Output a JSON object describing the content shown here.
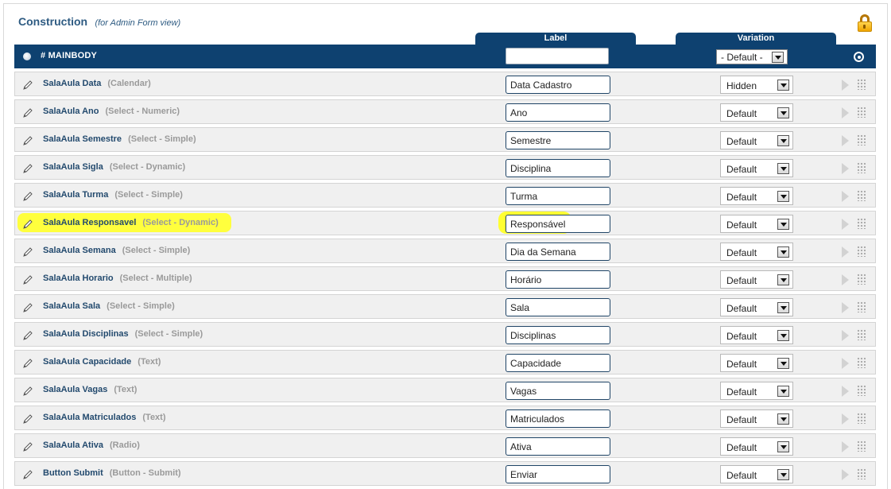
{
  "header": {
    "title": "Construction",
    "subtitle": "(for Admin Form view)"
  },
  "columns": {
    "label": "Label",
    "variation": "Variation"
  },
  "mainbody": {
    "title": "# MAINBODY",
    "label_value": "",
    "variation_value": "- Default -"
  },
  "rows": [
    {
      "name": "SalaAula Data",
      "type": "(Calendar)",
      "label": "Data Cadastro",
      "variation": "Hidden",
      "highlight": false
    },
    {
      "name": "SalaAula Ano",
      "type": "(Select - Numeric)",
      "label": "Ano",
      "variation": "Default",
      "highlight": false
    },
    {
      "name": "SalaAula Semestre",
      "type": "(Select - Simple)",
      "label": "Semestre",
      "variation": "Default",
      "highlight": false
    },
    {
      "name": "SalaAula Sigla",
      "type": "(Select - Dynamic)",
      "label": "Disciplina",
      "variation": "Default",
      "highlight": false
    },
    {
      "name": "SalaAula Turma",
      "type": "(Select - Simple)",
      "label": "Turma",
      "variation": "Default",
      "highlight": false
    },
    {
      "name": "SalaAula Responsavel",
      "type": "(Select - Dynamic)",
      "label": "Responsável",
      "variation": "Default",
      "highlight": true
    },
    {
      "name": "SalaAula Semana",
      "type": "(Select - Simple)",
      "label": "Dia da Semana",
      "variation": "Default",
      "highlight": false
    },
    {
      "name": "SalaAula Horario",
      "type": "(Select - Multiple)",
      "label": "Horário",
      "variation": "Default",
      "highlight": false
    },
    {
      "name": "SalaAula Sala",
      "type": "(Select - Simple)",
      "label": "Sala",
      "variation": "Default",
      "highlight": false
    },
    {
      "name": "SalaAula Disciplinas",
      "type": "(Select - Simple)",
      "label": "Disciplinas",
      "variation": "Default",
      "highlight": false
    },
    {
      "name": "SalaAula Capacidade",
      "type": "(Text)",
      "label": "Capacidade",
      "variation": "Default",
      "highlight": false
    },
    {
      "name": "SalaAula Vagas",
      "type": "(Text)",
      "label": "Vagas",
      "variation": "Default",
      "highlight": false
    },
    {
      "name": "SalaAula Matriculados",
      "type": "(Text)",
      "label": "Matriculados",
      "variation": "Default",
      "highlight": false
    },
    {
      "name": "SalaAula Ativa",
      "type": "(Radio)",
      "label": "Ativa",
      "variation": "Default",
      "highlight": false
    },
    {
      "name": "Button Submit",
      "type": "(Button - Submit)",
      "label": "Enviar",
      "variation": "Default",
      "highlight": false
    }
  ],
  "icons": {
    "lock": "lock-icon",
    "edit": "pencil-icon",
    "publish": "arrow-right-icon",
    "drag": "drag-handle-icon",
    "mainbody_bullet": "radio-dot-icon",
    "mainbody_settings": "target-icon"
  },
  "colors": {
    "header_bar": "#0e4170",
    "title": "#2e5b82",
    "highlight": "#ffff33"
  }
}
